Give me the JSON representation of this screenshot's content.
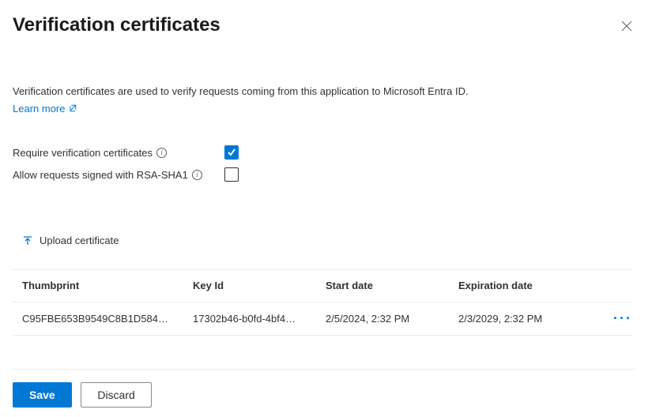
{
  "header": {
    "title": "Verification certificates"
  },
  "description": "Verification certificates are used to verify requests coming from this application to Microsoft Entra ID.",
  "learn_more_label": "Learn more",
  "options": {
    "require_label": "Require verification certificates",
    "require_checked": true,
    "allow_rsa_label": "Allow requests signed with RSA-SHA1",
    "allow_rsa_checked": false
  },
  "upload_label": "Upload certificate",
  "table": {
    "headers": {
      "thumbprint": "Thumbprint",
      "key_id": "Key Id",
      "start_date": "Start date",
      "expiration_date": "Expiration date"
    },
    "rows": [
      {
        "thumbprint": "C95FBE653B9549C8B1D584…",
        "key_id": "17302b46-b0fd-4bf4…",
        "start_date": "2/5/2024, 2:32 PM",
        "expiration_date": "2/3/2029, 2:32 PM"
      }
    ]
  },
  "footer": {
    "save_label": "Save",
    "discard_label": "Discard"
  }
}
